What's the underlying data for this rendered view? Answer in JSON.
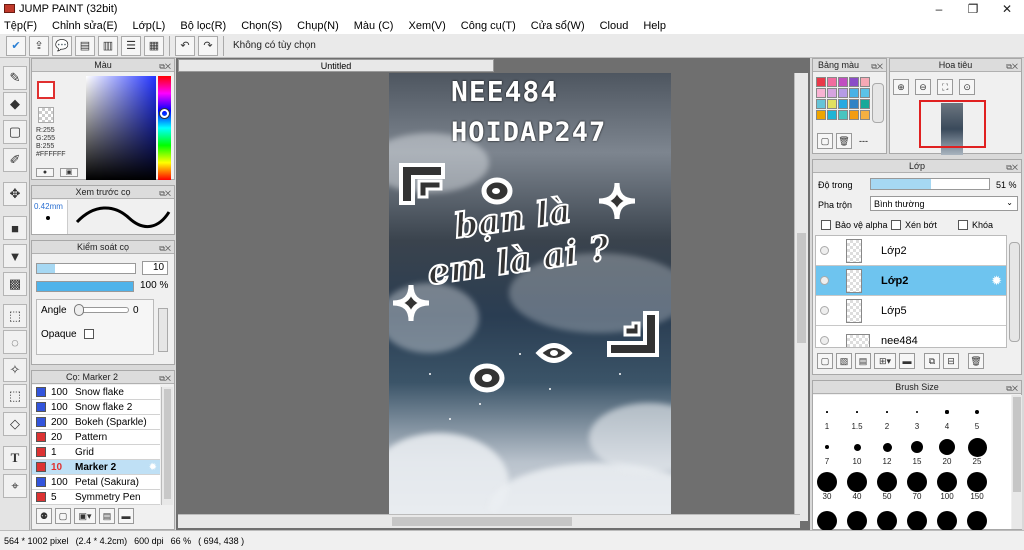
{
  "app": {
    "title": "JUMP PAINT (32bit)"
  },
  "window": {
    "minimize": "–",
    "maximize": "❐",
    "close": "✕"
  },
  "menu": [
    "Tệp(F)",
    "Chỉnh sửa(E)",
    "Lớp(L)",
    "Bộ lọc(R)",
    "Chọn(S)",
    "Chụp(N)",
    "Màu (C)",
    "Xem(V)",
    "Công cụ(T)",
    "Cửa sổ(W)",
    "Cloud",
    "Help"
  ],
  "toolbar": {
    "status": "Không có tùy chọn",
    "undo_icon": "undo-icon",
    "redo_icon": "redo-icon"
  },
  "color_panel": {
    "title": "Màu",
    "r": "R:255",
    "g": "G:255",
    "b": "B:255",
    "hex": "#FFFFFF",
    "main_color": "#e03030"
  },
  "preview_panel": {
    "title": "Xem trước cọ",
    "size": "0.42mm"
  },
  "brush_control": {
    "title": "Kiểm soát cọ",
    "size_value": "10",
    "opacity": "100 %",
    "angle_label": "Angle",
    "angle_value": "0",
    "opaque_label": "Opaque"
  },
  "brush_list": {
    "title": "Cọ: Marker 2",
    "items": [
      {
        "size": "100",
        "name": "Snow flake",
        "color": "#3355dd"
      },
      {
        "size": "100",
        "name": "Snow flake 2",
        "color": "#3355dd"
      },
      {
        "size": "200",
        "name": "Bokeh (Sparkle)",
        "color": "#3355dd"
      },
      {
        "size": "20",
        "name": "Pattern",
        "color": "#dd3333"
      },
      {
        "size": "1",
        "name": "Grid",
        "color": "#dd3333"
      },
      {
        "size": "10",
        "name": "Marker 2",
        "color": "#dd3333",
        "selected": true
      },
      {
        "size": "100",
        "name": "Petal (Sakura)",
        "color": "#3355dd"
      },
      {
        "size": "5",
        "name": "Symmetry Pen",
        "color": "#dd3333"
      }
    ]
  },
  "document": {
    "tab": "Untitled",
    "text1": "NEE484",
    "text2": "HOIDAP247",
    "text3": "bạn là",
    "text4": "em là ai ?"
  },
  "palette_panel": {
    "title": "Bảng màu",
    "swatches": [
      "#e8394a",
      "#f26c9f",
      "#c04fc0",
      "#8a4cc7",
      "#f6a9b5",
      "#f9b3d3",
      "#d6a3e0",
      "#b59be6",
      "#49b2e6",
      "#5bc2e7",
      "#66c4d8",
      "#e0e060",
      "#27a9e1",
      "#2f83c5",
      "#18a99a",
      "#f0a500",
      "#1fb5d6",
      "#49c5c0",
      "#f39c12",
      "#f5b041"
    ]
  },
  "navigator": {
    "title": "Hoa tiêu"
  },
  "layer_panel": {
    "title": "Lớp",
    "opacity_label": "Độ trong",
    "opacity_value": "51 %",
    "opacity_level": 0.51,
    "blend_label": "Pha trộn",
    "blend_value": "Bình thường",
    "protect_alpha": "Bảo vệ alpha",
    "clip": "Xén bớt",
    "lock": "Khóa",
    "layers": [
      {
        "name": "Lớp2",
        "selected": false
      },
      {
        "name": "Lớp2",
        "selected": true
      },
      {
        "name": "Lớp5",
        "selected": false
      },
      {
        "name": "nee484",
        "selected": false
      }
    ]
  },
  "brush_size": {
    "title": "Brush Size",
    "labels": [
      "1",
      "1.5",
      "2",
      "3",
      "4",
      "5",
      "7",
      "10",
      "12",
      "15",
      "20",
      "25",
      "30",
      "40",
      "50",
      "70",
      "100",
      "150"
    ]
  },
  "status": {
    "size": "564 * 1002 pixel",
    "cm": "(2.4 * 4.2cm)",
    "dpi": "600 dpi",
    "zoom": "66 %",
    "coords": "( 694, 438 )"
  }
}
